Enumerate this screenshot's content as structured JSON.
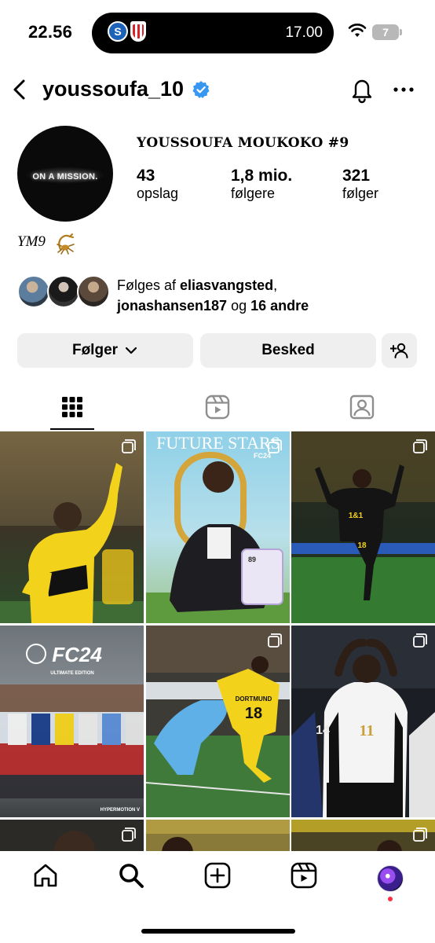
{
  "status_bar": {
    "time": "22.56",
    "live_activity": {
      "team1_badge": "S",
      "team1_color": "#1c63b7",
      "team2_color": "#d9202b",
      "match_time": "17.00"
    },
    "battery_level": "7"
  },
  "header": {
    "username": "youssoufa_10",
    "verified": true,
    "icons": [
      "back-chevron-icon",
      "verified-badge-icon",
      "notification-bell-icon",
      "more-icon"
    ]
  },
  "profile": {
    "avatar_text": "ON A MISSION.",
    "display_name": "YOUSSOUFA MOUKOKO #9",
    "stats": [
      {
        "value": "43",
        "label": "opslag"
      },
      {
        "value": "1,8 mio.",
        "label": "følgere"
      },
      {
        "value": "321",
        "label": "følger"
      }
    ],
    "bio": "YM9"
  },
  "followed_by": {
    "prefix": "Følges af ",
    "user1": "eliasvangsted",
    "comma": ",",
    "user2": "jonashansen187",
    "joiner": " og ",
    "others": "16 andre"
  },
  "actions": {
    "follow_label": "Følger",
    "message_label": "Besked"
  },
  "tabs": [
    "grid-icon",
    "reels-icon",
    "tagged-icon"
  ],
  "posts": {
    "tile2_title": "FUTURE STARS",
    "tile2_badge": "FC24",
    "tile2_card_rating": "89",
    "tile4_logo": "FC24",
    "tile4_edition": "ULTIMATE EDITION",
    "tile4_footer": "HYPERMOTION V",
    "tile5_shirt_name": "DORTMUND",
    "tile5_shirt_number": "18",
    "tile6_shirt_number": "11",
    "tile6_bg_number": "14",
    "tile3_sponsor": "1&1",
    "tile3_number": "18"
  },
  "bottom_nav": [
    "home-icon",
    "search-icon",
    "create-icon",
    "reels-icon",
    "profile-avatar"
  ],
  "colors": {
    "accent_blue": "#0095f6",
    "verified": "#3897f0",
    "button_bg": "#efefef",
    "notification_dot": "#ff3040",
    "bvb_yellow": "#fde100"
  }
}
